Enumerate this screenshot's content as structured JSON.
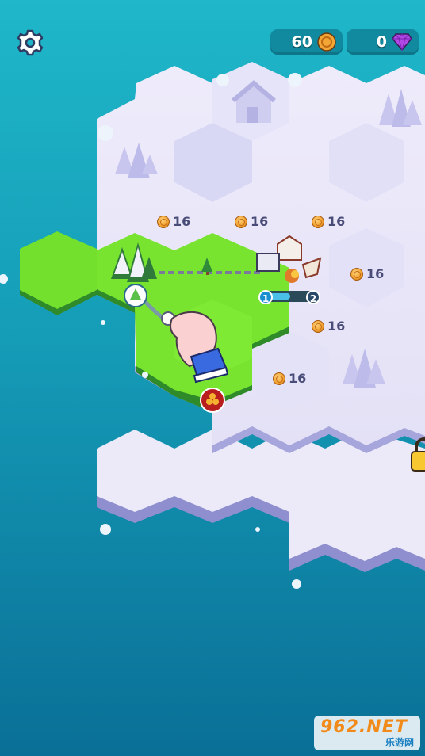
{
  "hud": {
    "coins": "60",
    "gems": "0"
  },
  "tile_prices": [
    {
      "id": "price-1",
      "label": "16"
    },
    {
      "id": "price-2",
      "label": "16"
    },
    {
      "id": "price-3",
      "label": "16"
    },
    {
      "id": "price-4",
      "label": "16"
    },
    {
      "id": "price-5",
      "label": "16"
    },
    {
      "id": "price-6",
      "label": "16"
    }
  ],
  "level_badges": {
    "start": "1",
    "end": "2"
  },
  "watermark": {
    "main": "962.NET",
    "sub": "乐游网"
  },
  "icons": [
    "settings-gear-icon",
    "coin-icon",
    "gem-icon",
    "tree-icon",
    "lock-icon",
    "resource-icon",
    "tap-hand-icon"
  ],
  "colors": {
    "water": "#1fb7c9",
    "grass": "#6ee02a",
    "snow": "#e9e6f8",
    "locked_snow": "#d4d3f2",
    "coin": "#f0a030",
    "gem": "#a23ad8"
  }
}
